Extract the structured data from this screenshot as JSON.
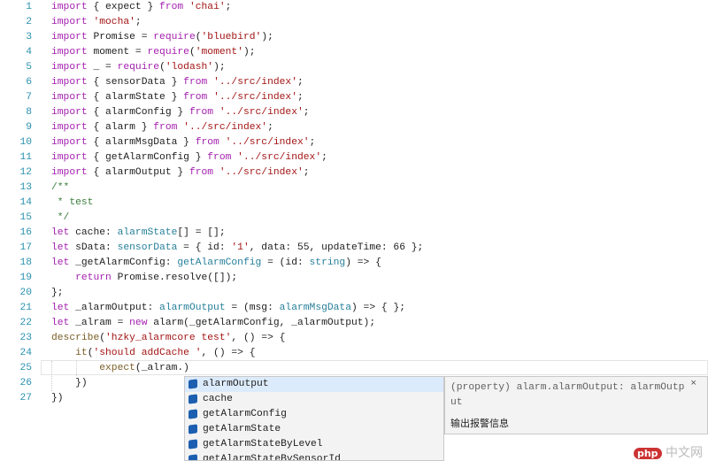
{
  "editor": {
    "lines": [
      [
        [
          "kw",
          "import"
        ],
        [
          "",
          "{ expect } "
        ],
        [
          "kw",
          "from"
        ],
        [
          "str",
          " 'chai'"
        ],
        [
          "",
          ";"
        ]
      ],
      [
        [
          "kw",
          "import"
        ],
        [
          "str",
          " 'mocha'"
        ],
        [
          "",
          ";"
        ]
      ],
      [
        [
          "kw",
          "import"
        ],
        [
          "",
          "Promise = "
        ],
        [
          "kw",
          "require"
        ],
        [
          "",
          "("
        ],
        [
          "str",
          "'bluebird'"
        ],
        [
          "",
          ");"
        ]
      ],
      [
        [
          "kw",
          "import"
        ],
        [
          "",
          "moment = "
        ],
        [
          "kw",
          "require"
        ],
        [
          "",
          "("
        ],
        [
          "str",
          "'moment'"
        ],
        [
          "",
          ");"
        ]
      ],
      [
        [
          "kw",
          "import"
        ],
        [
          "",
          "_ = "
        ],
        [
          "kw",
          "require"
        ],
        [
          "",
          "("
        ],
        [
          "str",
          "'lodash'"
        ],
        [
          "",
          ");"
        ]
      ],
      [
        [
          "kw",
          "import"
        ],
        [
          "",
          "{ sensorData } "
        ],
        [
          "kw",
          "from"
        ],
        [
          "str",
          " '../src/index'"
        ],
        [
          "",
          ";"
        ]
      ],
      [
        [
          "kw",
          "import"
        ],
        [
          "",
          "{ alarmState } "
        ],
        [
          "kw",
          "from"
        ],
        [
          "str",
          " '../src/index'"
        ],
        [
          "",
          ";"
        ]
      ],
      [
        [
          "kw",
          "import"
        ],
        [
          "",
          "{ alarmConfig } "
        ],
        [
          "kw",
          "from"
        ],
        [
          "str",
          " '../src/index'"
        ],
        [
          "",
          ";"
        ]
      ],
      [
        [
          "kw",
          "import"
        ],
        [
          "",
          "{ alarm } "
        ],
        [
          "kw",
          "from"
        ],
        [
          "str",
          " '../src/index'"
        ],
        [
          "",
          ";"
        ]
      ],
      [
        [
          "kw",
          "import"
        ],
        [
          "",
          "{ alarmMsgData } "
        ],
        [
          "kw",
          "from"
        ],
        [
          "str",
          " '../src/index'"
        ],
        [
          "",
          ";"
        ]
      ],
      [
        [
          "kw",
          "import"
        ],
        [
          "",
          "{ getAlarmConfig } "
        ],
        [
          "kw",
          "from"
        ],
        [
          "str",
          " '../src/index'"
        ],
        [
          "",
          ";"
        ]
      ],
      [
        [
          "kw",
          "import"
        ],
        [
          "",
          "{ alarmOutput } "
        ],
        [
          "kw",
          "from"
        ],
        [
          "str",
          " '../src/index'"
        ],
        [
          "",
          ";"
        ]
      ],
      [
        [
          "cm",
          "/**"
        ]
      ],
      [
        [
          "cm",
          " * test"
        ]
      ],
      [
        [
          "cm",
          " */"
        ]
      ],
      [
        [
          "kw",
          "let"
        ],
        [
          "",
          " cache: "
        ],
        [
          "ty",
          "alarmState"
        ],
        [
          "",
          "[] = [];"
        ]
      ],
      [
        [
          "kw",
          "let"
        ],
        [
          "",
          " sData: "
        ],
        [
          "ty",
          "sensorData"
        ],
        [
          "",
          " = { id: "
        ],
        [
          "str",
          "'1'"
        ],
        [
          "",
          ", data: 55, updateTime: 66 };"
        ]
      ],
      [
        [
          "kw",
          "let"
        ],
        [
          "",
          " _getAlarmConfig: "
        ],
        [
          "ty",
          "getAlarmConfig"
        ],
        [
          "",
          " = (id: "
        ],
        [
          "ty",
          "string"
        ],
        [
          "",
          ") => {"
        ]
      ],
      [
        [
          "",
          "    "
        ],
        [
          "kw",
          "return"
        ],
        [
          "",
          " Promise.resolve([]);"
        ]
      ],
      [
        [
          "",
          "};"
        ]
      ],
      [
        [
          "kw",
          "let"
        ],
        [
          "",
          " _alarmOutput: "
        ],
        [
          "ty",
          "alarmOutput"
        ],
        [
          "",
          " = (msg: "
        ],
        [
          "ty",
          "alarmMsgData"
        ],
        [
          "",
          ") => { };"
        ]
      ],
      [
        [
          "kw",
          "let"
        ],
        [
          "",
          " _alram = "
        ],
        [
          "kw",
          "new"
        ],
        [
          "",
          " alarm(_getAlarmConfig, _alarmOutput);"
        ]
      ],
      [
        [
          "fn",
          "describe"
        ],
        [
          "",
          "("
        ],
        [
          "str",
          "'hzky_alarmcore test'"
        ],
        [
          "",
          ", () => {"
        ]
      ],
      [
        [
          "",
          "    "
        ],
        [
          "fn",
          "it"
        ],
        [
          "",
          "("
        ],
        [
          "str",
          "'should addCache '"
        ],
        [
          "",
          ", () => {"
        ]
      ],
      [
        [
          "",
          "        "
        ],
        [
          "fn",
          "expect"
        ],
        [
          "",
          "(_alram.)"
        ]
      ],
      [
        [
          "",
          "    })"
        ]
      ],
      [
        [
          "",
          "})"
        ]
      ]
    ]
  },
  "suggest": {
    "items": [
      "alarmOutput",
      "cache",
      "getAlarmConfig",
      "getAlarmState",
      "getAlarmStateByLevel",
      "getAlarmStateBySensorId"
    ],
    "selected": 0
  },
  "details": {
    "signature": "(property) alarm.alarmOutput: alarmOutput",
    "doc": "输出报警信息",
    "close": "×"
  },
  "watermark": {
    "logo": "php",
    "text": "中文网"
  }
}
